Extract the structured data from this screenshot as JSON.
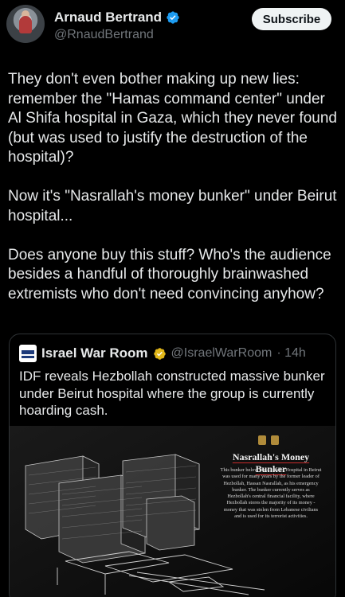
{
  "author": {
    "name": "Arnaud Bertrand",
    "handle": "@RnaudBertrand",
    "subscribe_label": "Subscribe"
  },
  "tweet": {
    "paragraphs": [
      "They don't even bother making up new lies: remember the \"Hamas command center\" under Al Shifa hospital in Gaza, which they never found (but was used to justify the destruction of the hospital)?",
      "Now it's \"Nasrallah's money bunker\" under Beirut hospital...",
      "Does anyone buy this stuff? Who's the audience besides a handful of thoroughly brainwashed extremists who don't need convincing anyhow?"
    ]
  },
  "quote": {
    "name": "Israel War Room",
    "handle": "@IsraelWarRoom",
    "time": "· 14h",
    "avatar_text": "ISRAEL",
    "text": "IDF reveals Hezbollah constructed massive bunker under Beirut hospital where the group is currently hoarding cash.",
    "media": {
      "title": "Nasrallah's Money Bunker",
      "body": "This bunker below the Al-Sahel Hospital in Beirut was used for many years by the former leader of Hezbollah, Hassan Nasrallah, as his emergency bunker. The bunker currently serves as Hezbollah's central financial facility, where Hezbollah stores the majority of its money - money that was stolen from Lebanese civilians and is used for its terrorist activities."
    }
  },
  "colors": {
    "background": "#000000",
    "text": "#e7e9ea",
    "secondary_text": "#71767b",
    "verified_blue": "#1d9bf0",
    "affiliate_gold": "#e2b719",
    "media_accent": "#c72a2a"
  },
  "icons": {
    "verified": "verified-badge-icon",
    "affiliate": "gold-verified-badge-icon"
  }
}
